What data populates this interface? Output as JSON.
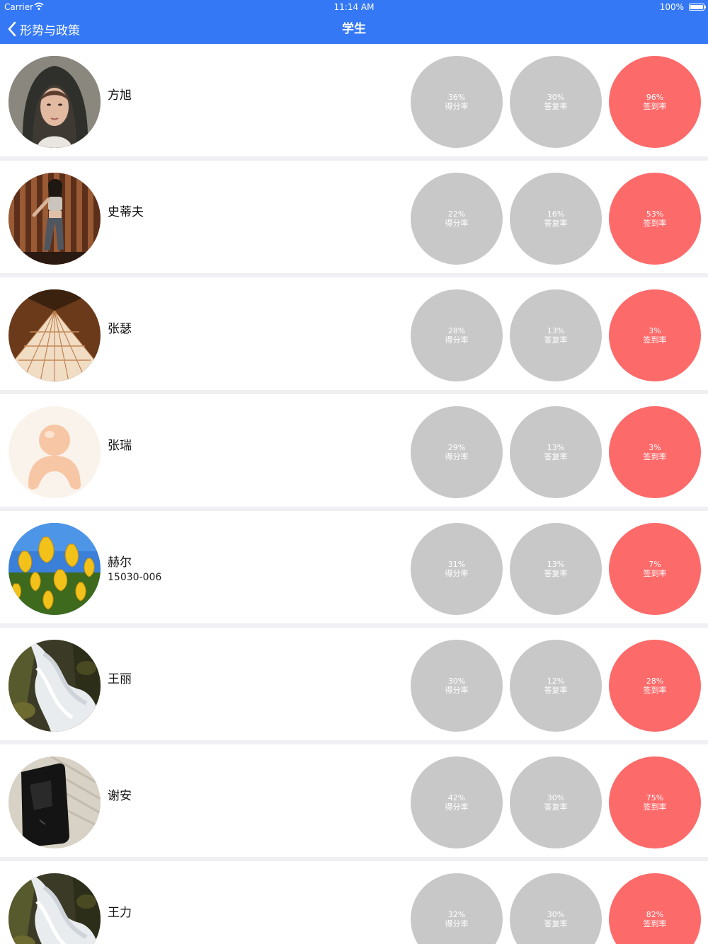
{
  "status_bar": {
    "carrier": "Carrier",
    "time": "11:14 AM",
    "battery": "100%"
  },
  "nav": {
    "back_label": "形势与政策",
    "title": "学生"
  },
  "colors": {
    "nav_bar": "#3478f6",
    "stat_gray": "#c8c8c8",
    "stat_red": "#fd6a6a",
    "separator": "#efeff4"
  },
  "metric_labels": {
    "score": "得分率",
    "reply": "答复率",
    "checkin": "签到率"
  },
  "students": [
    {
      "name": "方旭",
      "sub": "",
      "avatar": "woman-hood-photo",
      "score": "36%",
      "reply": "30%",
      "checkin": "96%"
    },
    {
      "name": "史蒂夫",
      "sub": "",
      "avatar": "woman-wood-wall-photo",
      "score": "22%",
      "reply": "16%",
      "checkin": "53%"
    },
    {
      "name": "张瑟",
      "sub": "",
      "avatar": "architecture-photo",
      "score": "28%",
      "reply": "13%",
      "checkin": "3%"
    },
    {
      "name": "张瑞",
      "sub": "",
      "avatar": "default-person-avatar",
      "score": "29%",
      "reply": "13%",
      "checkin": "3%"
    },
    {
      "name": "赫尔",
      "sub": "15030-006",
      "avatar": "tulips-photo",
      "score": "31%",
      "reply": "13%",
      "checkin": "7%"
    },
    {
      "name": "王丽",
      "sub": "",
      "avatar": "waterfall-photo",
      "score": "30%",
      "reply": "12%",
      "checkin": "28%"
    },
    {
      "name": "谢安",
      "sub": "",
      "avatar": "phone-photo",
      "score": "42%",
      "reply": "30%",
      "checkin": "75%"
    },
    {
      "name": "王力",
      "sub": "",
      "avatar": "waterfall-photo",
      "score": "32%",
      "reply": "30%",
      "checkin": "82%"
    }
  ]
}
